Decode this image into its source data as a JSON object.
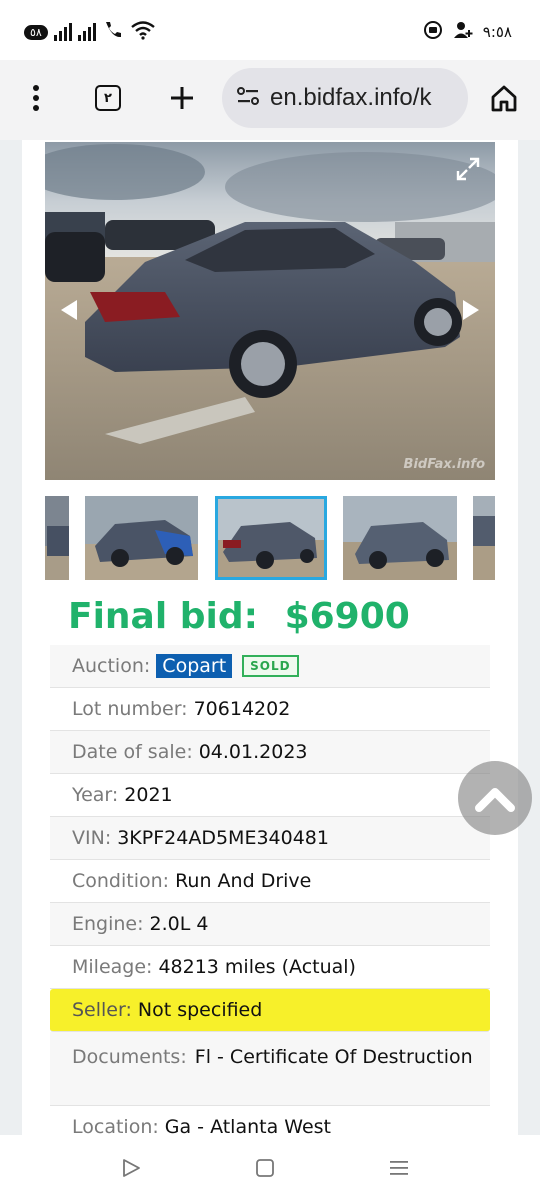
{
  "status_bar": {
    "left_pill": "٥٨",
    "time": "٩:٥٨",
    "icons": [
      "wifi-call-icon",
      "signal-icon",
      "signal-icon",
      "phone-icon",
      "wifi-icon",
      "record-icon",
      "person-plus-icon"
    ]
  },
  "browser": {
    "url": "en.bidfax.info/k",
    "tab_count": "٢",
    "icons": [
      "menu-dots-icon",
      "tabs-icon",
      "plus-icon",
      "site-settings-icon",
      "home-icon"
    ]
  },
  "listing": {
    "final_bid_label": "Final bid:",
    "final_bid_value": "$6900",
    "watermark": "BidFax.info",
    "rows": {
      "auction": {
        "label": "Auction:",
        "value": "Copart",
        "badge": "SOLD"
      },
      "lot": {
        "label": "Lot number:",
        "value": "70614202"
      },
      "date": {
        "label": "Date of sale:",
        "value": "04.01.2023"
      },
      "year": {
        "label": "Year:",
        "value": "2021"
      },
      "vin": {
        "label": "VIN:",
        "value": "3KPF24AD5ME340481"
      },
      "condition": {
        "label": "Condition:",
        "value": "Run And Drive"
      },
      "engine": {
        "label": "Engine:",
        "value": "2.0L 4"
      },
      "mileage": {
        "label": "Mileage:",
        "value": "48213 miles (Actual)"
      },
      "seller": {
        "label": "Seller:",
        "value": "Not specified"
      },
      "documents": {
        "label": "Documents:",
        "value": "Fl - Certificate Of Destruction"
      },
      "location": {
        "label": "Location:",
        "value": "Ga - Atlanta West"
      }
    }
  },
  "colors": {
    "final_bid": "#20b26b",
    "copart_badge": "#0d5fb0",
    "sold_badge": "#32b05a",
    "seller_highlight": "#f7f02a",
    "active_thumb": "#29a8e0"
  }
}
